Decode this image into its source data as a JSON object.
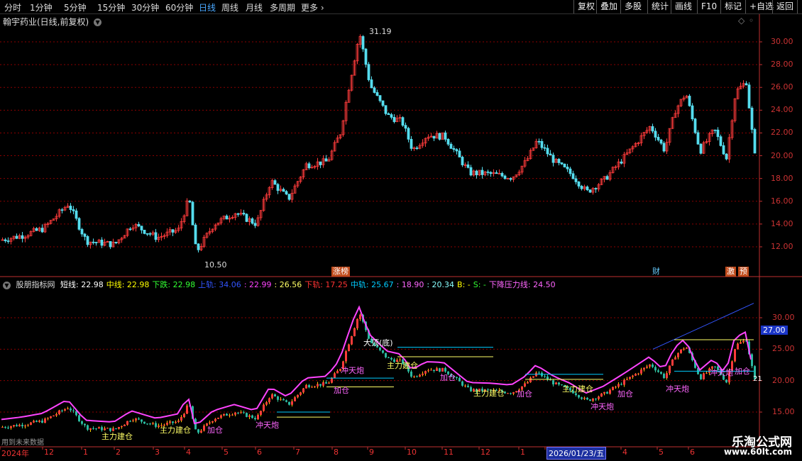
{
  "toolbar": {
    "periods": [
      "分时",
      "1分钟",
      "5分钟",
      "15分钟",
      "30分钟",
      "60分钟",
      "日线",
      "周线",
      "月线",
      "多周期",
      "更多"
    ],
    "active_period": "日线",
    "right_buttons": [
      "复权",
      "叠加",
      "多股",
      "统计",
      "画线",
      "F10",
      "标记",
      "+自选",
      "返回"
    ]
  },
  "main_chart": {
    "title": "翰宇药业(日线,前复权)",
    "high_label": "31.19",
    "low_label": "10.50",
    "y_ticks": [
      "30.00",
      "28.00",
      "26.00",
      "24.00",
      "22.00",
      "20.00",
      "18.00",
      "16.00",
      "14.00",
      "12.00"
    ],
    "events": [
      "涨榜",
      "财",
      "激",
      "预"
    ]
  },
  "indicator": {
    "name": "股朋指标网",
    "values": [
      {
        "label": "短线:",
        "value": "22.98",
        "color": "#ffffff"
      },
      {
        "label": "中线:",
        "value": "22.98",
        "color": "#ffff00"
      },
      {
        "label": "下跌:",
        "value": "22.98",
        "color": "#33ff33"
      },
      {
        "label": "上轨:",
        "value": "34.06",
        "color": "#3355ff"
      },
      {
        "label": ":",
        "value": "22.99",
        "color": "#ff44ff"
      },
      {
        "label": ":",
        "value": "26.56",
        "color": "#ffff66"
      },
      {
        "label": "下轨:",
        "value": "17.25",
        "color": "#ff3333"
      },
      {
        "label": "中轨:",
        "value": "25.67",
        "color": "#00ccff"
      },
      {
        "label": ":",
        "value": "18.90",
        "color": "#ff66ff"
      },
      {
        "label": ":",
        "value": "20.34",
        "color": "#88ffff"
      },
      {
        "label": "B:",
        "value": "-",
        "color": "#ffff00"
      },
      {
        "label": "S:",
        "value": "-",
        "color": "#33ff33"
      },
      {
        "label": "下降压力线:",
        "value": "24.50",
        "color": "#ff66ff"
      }
    ],
    "y_ticks": [
      "30.00",
      "25.00",
      "20.00",
      "15.00"
    ],
    "current_price": "27.00",
    "right_label": "21",
    "annotations": [
      {
        "text": "大顶(底)",
        "color": "#ffffff"
      },
      {
        "text": "主力建仓",
        "color": "#ffff66"
      },
      {
        "text": "冲天炮",
        "color": "#ff66ff"
      },
      {
        "text": "加仓",
        "color": "#ff66ff"
      },
      {
        "text": "主力建仓",
        "color": "#ffff66"
      },
      {
        "text": "主力建仓",
        "color": "#ffff66"
      },
      {
        "text": "冲天炮",
        "color": "#ff66ff"
      },
      {
        "text": "加仓",
        "color": "#ff66ff"
      },
      {
        "text": "冲天炮",
        "color": "#ff66ff"
      },
      {
        "text": "加仓",
        "color": "#ff66ff"
      },
      {
        "text": "主力建仓",
        "color": "#ffff66"
      },
      {
        "text": "冲天炮",
        "color": "#ff66ff"
      },
      {
        "text": "加仓",
        "color": "#ff66ff"
      },
      {
        "text": "主力建仓",
        "color": "#ffff66"
      },
      {
        "text": "加仓",
        "color": "#ff66ff"
      },
      {
        "text": "冲天炮",
        "color": "#ff66ff"
      },
      {
        "text": "加仓",
        "color": "#ff66ff"
      }
    ],
    "bottom_left_note": "用到未来数据"
  },
  "date_axis": {
    "labels": [
      "2024年",
      "12",
      "1",
      "2",
      "3",
      "4",
      "5",
      "6",
      "7",
      "8",
      "9",
      "10",
      "11",
      "12",
      "1",
      "2026/01/23/五",
      "4",
      "5",
      "6"
    ]
  },
  "watermark": {
    "line1": "乐淘公式网",
    "line2": "www.60lt.com"
  },
  "colors": {
    "grid": "#8b0000",
    "up": "#ff3b3b",
    "down": "#55ddee",
    "axis": "#c03030"
  }
}
